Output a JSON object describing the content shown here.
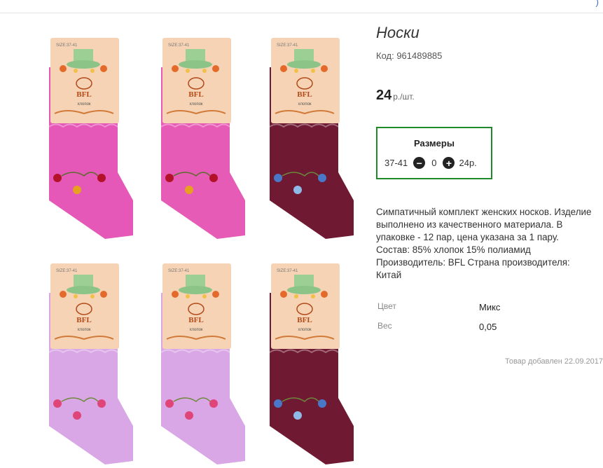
{
  "product": {
    "title": "Носки",
    "code": "Код: 961489885",
    "price_value": "24",
    "price_unit": "р./шт.",
    "description_lines": [
      "Симпатичный комплект женских носков. Изделие",
      "выполнено из качественного материала. В",
      "упаковке - 12 пар, цена указана за 1 пару.",
      "Состав: 85% хлопок 15% полиамид",
      "Производитель: BFL Страна производителя:",
      "Китай"
    ],
    "added": "Товар добавлен 22.09.2017"
  },
  "sizes": {
    "title": "Размеры",
    "row": {
      "size": "37-41",
      "quantity": "0",
      "price": "24р."
    }
  },
  "properties": [
    {
      "label": "Цвет",
      "value": "Микс"
    },
    {
      "label": "Вес",
      "value": "0,05"
    }
  ],
  "gallery": {
    "brand": "BFL",
    "material": "хлопок",
    "size_tag": "SIZE:37-41",
    "socks": [
      {
        "color": "#e558b8",
        "pattern": "red"
      },
      {
        "color": "#e65bb5",
        "pattern": "red"
      },
      {
        "color": "#6f1a32",
        "pattern": "blue"
      },
      {
        "color": "#d9a6e6",
        "pattern": "pink"
      },
      {
        "color": "#d9a6e6",
        "pattern": "pink"
      },
      {
        "color": "#6f1a32",
        "pattern": "blue"
      }
    ]
  },
  "icons": {
    "minus": "minus-circle-icon",
    "plus": "plus-circle-icon"
  },
  "colors": {
    "size_box_border": "#1f8a2a",
    "label_bg": "#f6d3b4"
  }
}
